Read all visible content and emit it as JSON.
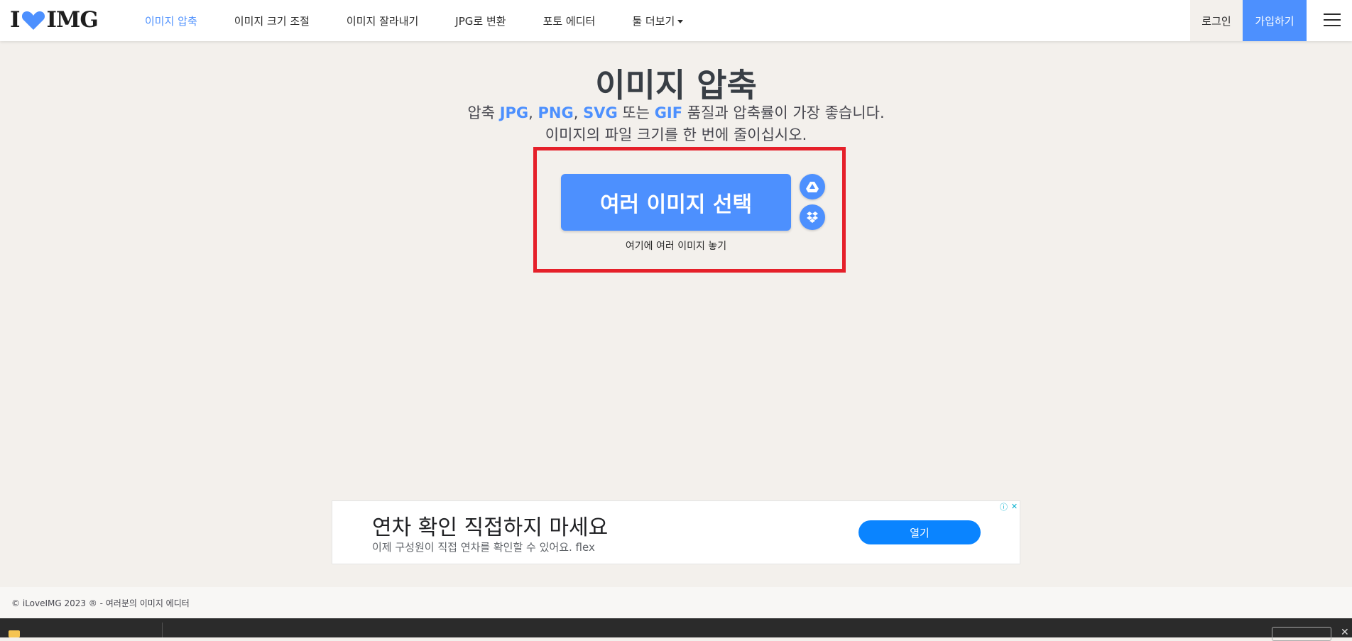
{
  "header": {
    "logo": {
      "left": "I",
      "right": "IMG"
    },
    "nav": [
      {
        "label": "이미지 압축",
        "active": true
      },
      {
        "label": "이미지 크기 조절"
      },
      {
        "label": "이미지 잘라내기"
      },
      {
        "label": "JPG로 변환"
      },
      {
        "label": "포토 에디터"
      },
      {
        "label": "툴 더보기"
      }
    ],
    "login_label": "로그인",
    "signup_label": "가입하기"
  },
  "hero": {
    "title": "이미지 압축",
    "subtitle_prefix": "압축 ",
    "formats": [
      "JPG",
      "PNG",
      "SVG",
      "GIF"
    ],
    "sep": ", ",
    "or": " 또는 ",
    "subtitle_suffix": " 품질과 압축률이 가장 좋습니다.",
    "subtitle_line2": "이미지의 파일 크기를 한 번에 줄이십시오.",
    "select_button": "여러 이미지 선택",
    "drop_text": "여기에 여러 이미지 놓기",
    "cloud_icons": [
      "google-drive-icon",
      "dropbox-icon"
    ]
  },
  "ad": {
    "headline": "연차 확인 직접하지 마세요",
    "description": "이제 구성원이 직접 연차를 확인할 수 있어요. flex",
    "cta": "열기"
  },
  "footer": {
    "text": "© iLoveIMG 2023 ® - 여러분의 이미지 에디터"
  },
  "colors": {
    "accent": "#4d90fe",
    "highlight": "#e5202a",
    "background": "#f3f0ec"
  }
}
